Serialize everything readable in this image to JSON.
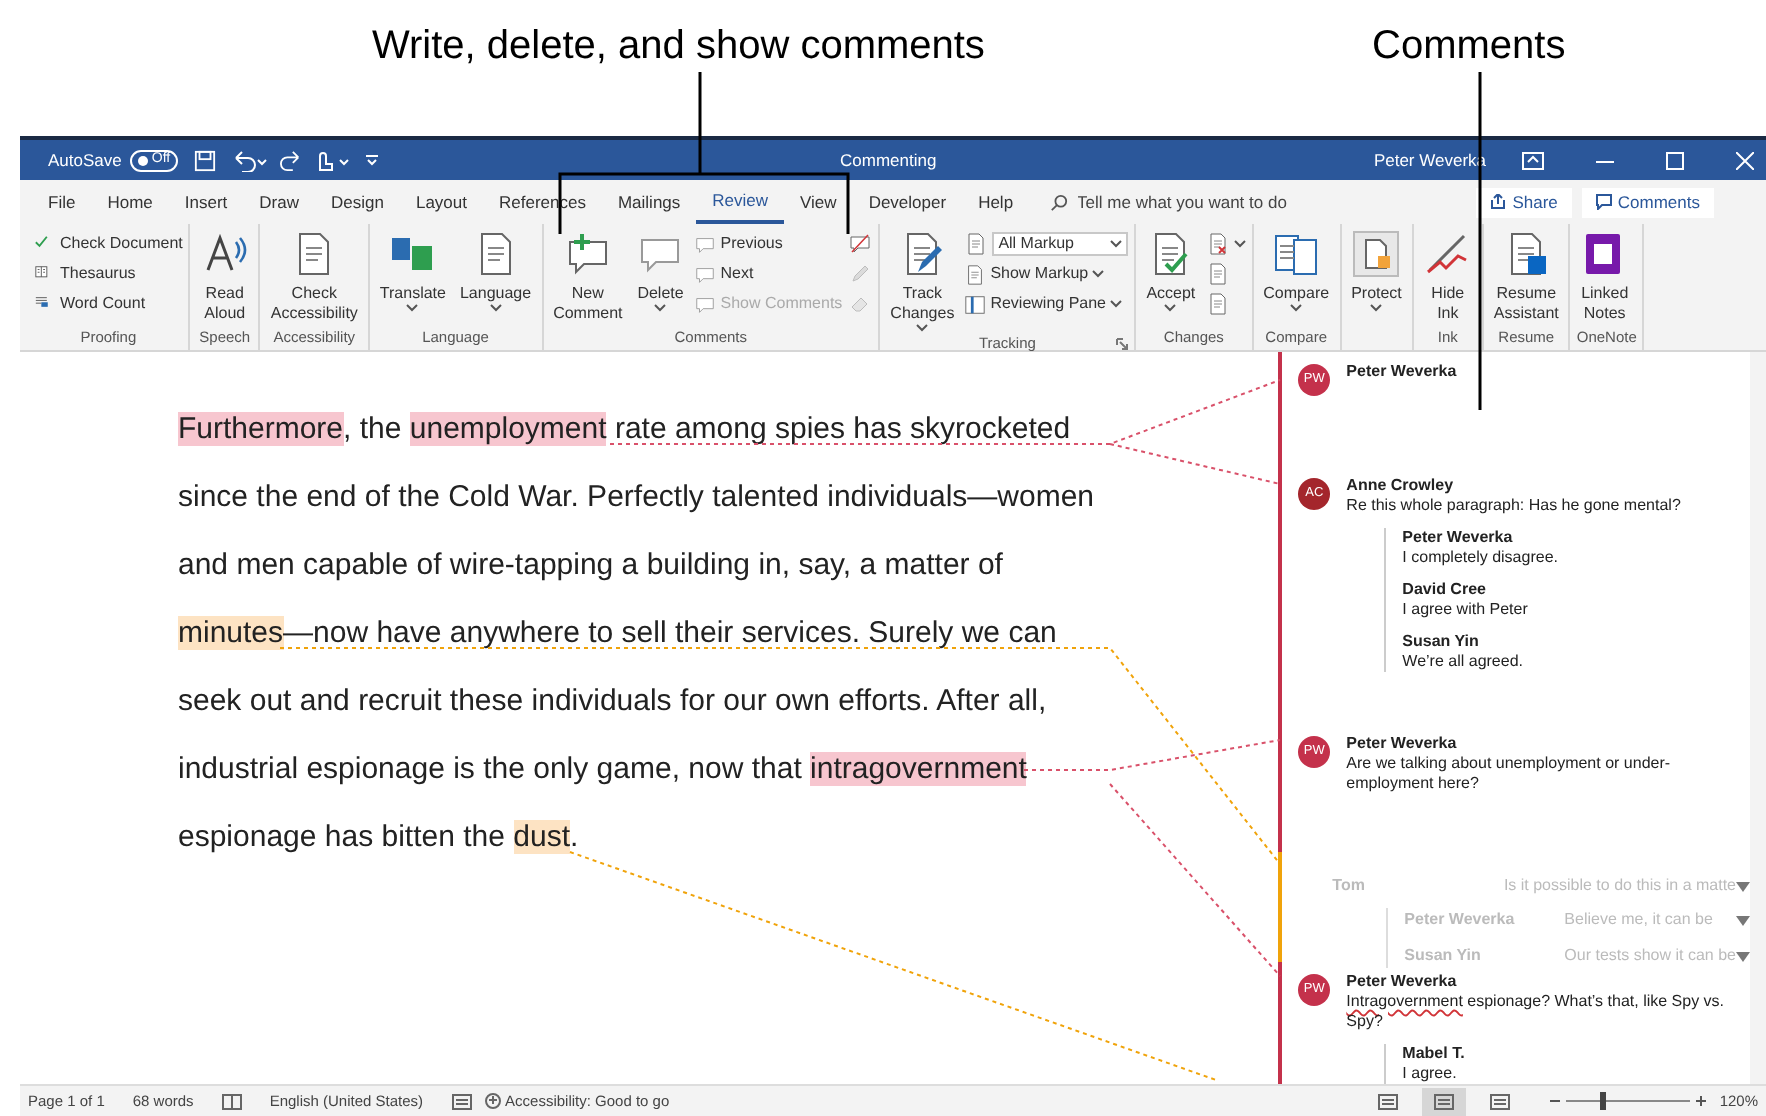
{
  "callouts": [
    {
      "text": "Write, delete, and show comments"
    },
    {
      "text": "Comments"
    }
  ],
  "title_bar": {
    "autosave": {
      "label": "AutoSave",
      "toggle": "Off",
      "on": false
    },
    "document_title": "Commenting",
    "user": "Peter Weverka"
  },
  "menu_tabs": [
    {
      "label": "File",
      "selected": false
    },
    {
      "label": "Home",
      "selected": false
    },
    {
      "label": "Insert",
      "selected": false
    },
    {
      "label": "Draw",
      "selected": false
    },
    {
      "label": "Design",
      "selected": false
    },
    {
      "label": "Layout",
      "selected": false
    },
    {
      "label": "References",
      "selected": false
    },
    {
      "label": "Mailings",
      "selected": false
    },
    {
      "label": "Review",
      "selected": true
    },
    {
      "label": "View",
      "selected": false
    },
    {
      "label": "Developer",
      "selected": false
    },
    {
      "label": "Help",
      "selected": false
    }
  ],
  "tell_me": {
    "placeholder": "Tell me what you want to do"
  },
  "share_button": "Share",
  "comments_button": "Comments",
  "ribbon_groups": [
    {
      "name": "Proofing",
      "buttons": [
        {
          "kind": "small",
          "label": "Check Document"
        },
        {
          "kind": "small",
          "label": "Thesaurus"
        },
        {
          "kind": "small",
          "label": "Word Count"
        }
      ]
    },
    {
      "name": "Speech",
      "buttons": [
        {
          "kind": "large",
          "label": "Read Aloud"
        }
      ]
    },
    {
      "name": "Accessibility",
      "buttons": [
        {
          "kind": "large",
          "label": "Check Accessibility"
        }
      ]
    },
    {
      "name": "Language",
      "buttons": [
        {
          "kind": "large",
          "label": "Translate",
          "dropdown": true
        },
        {
          "kind": "large",
          "label": "Language",
          "dropdown": true
        }
      ]
    },
    {
      "name": "Comments",
      "buttons": [
        {
          "kind": "large",
          "label": "New Comment"
        },
        {
          "kind": "large",
          "label": "Delete",
          "dropdown": true
        },
        {
          "kind": "small",
          "label": "Previous"
        },
        {
          "kind": "small",
          "label": "Next"
        },
        {
          "kind": "small",
          "label": "Show Comments",
          "disabled": true
        },
        {
          "kind": "icon"
        },
        {
          "kind": "icon",
          "disabled": true
        },
        {
          "kind": "icon",
          "disabled": true
        }
      ]
    },
    {
      "name": "Tracking",
      "launcher": true,
      "buttons": [
        {
          "kind": "large",
          "label": "Track Changes",
          "dropdown": true
        },
        {
          "kind": "select",
          "label": "All Markup"
        },
        {
          "kind": "small",
          "label": "Show Markup",
          "dropdown": true
        },
        {
          "kind": "small",
          "label": "Reviewing Pane",
          "dropdown": true
        }
      ]
    },
    {
      "name": "Changes",
      "buttons": [
        {
          "kind": "large",
          "label": "Accept",
          "dropdown": true
        },
        {
          "kind": "icon",
          "dropdown": true
        },
        {
          "kind": "icon"
        },
        {
          "kind": "icon"
        }
      ]
    },
    {
      "name": "Compare",
      "buttons": [
        {
          "kind": "large",
          "label": "Compare",
          "dropdown": true
        }
      ]
    },
    {
      "buttons": [
        {
          "kind": "large",
          "label": "Protect",
          "dropdown": true
        }
      ]
    },
    {
      "name": "Ink",
      "buttons": [
        {
          "kind": "large",
          "label": "Hide Ink"
        }
      ]
    },
    {
      "name": "Resume",
      "buttons": [
        {
          "kind": "large",
          "label": "Resume Assistant"
        }
      ]
    },
    {
      "name": "OneNote",
      "buttons": [
        {
          "kind": "large",
          "label": "Linked Notes"
        }
      ]
    }
  ],
  "document_lines": [
    [
      {
        "text": "Furthermore",
        "color": "#f7c6cf"
      },
      {
        "text": ", the "
      },
      {
        "text": "unemployment",
        "color": "#f7c6cf"
      },
      {
        "text": " rate among spies has skyrocketed"
      }
    ],
    [
      {
        "text": "since the end of the Cold War. Perfectly talented individuals—women"
      }
    ],
    [
      {
        "text": "and men capable of wire-tapping a building in, say, a matter of"
      }
    ],
    [
      {
        "text": "minutes",
        "color": "#fde3c3"
      },
      {
        "text": "—now have anywhere to sell their services. Surely we can"
      }
    ],
    [
      {
        "text": "seek out and recruit these individuals for our own efforts. After all,"
      }
    ],
    [
      {
        "text": "industrial espionage is the only game, now that "
      },
      {
        "text": "intragovernment",
        "color": "#f7c6cf"
      }
    ],
    [
      {
        "text": "espionage has bitten the "
      },
      {
        "text": "dust",
        "color": "#fde3c3"
      },
      {
        "text": "."
      }
    ]
  ],
  "comments": [
    {
      "initials": "PW",
      "author": "Peter Weverka",
      "color": "#c4314b",
      "resolved": false
    },
    {
      "initials": "AC",
      "author": "Anne Crowley",
      "color": "#a4262c",
      "resolved": false,
      "text": [
        {
          "text": "Re this whole paragraph: Has he gone mental?"
        }
      ],
      "replies": [
        {
          "author": "Peter Weverka",
          "text": "I completely disagree."
        },
        {
          "author": "David Cree",
          "text": "I agree with Peter"
        },
        {
          "author": "Susan Yin",
          "text": "We’re all agreed."
        }
      ]
    },
    {
      "initials": "PW",
      "author": "Peter Weverka",
      "color": "#c4314b",
      "resolved": false,
      "text": [
        {
          "text": "Are we talking about unemployment or under-employment here?"
        }
      ]
    },
    {
      "author": "Tom",
      "resolved": true,
      "text": [
        {
          "text": "Is it possible to do this in a matte"
        }
      ],
      "replies": [
        {
          "author": "Peter Weverka",
          "text": "Believe me, it can be"
        },
        {
          "author": "Susan Yin",
          "text": "Our tests show it can be"
        }
      ]
    },
    {
      "initials": "PW",
      "author": "Peter Weverka",
      "color": "#c4314b",
      "resolved": false,
      "text": [
        {
          "text": "Intragovernment",
          "misspelled": true
        },
        {
          "text": " espionage? What’s that, like Spy vs. Spy?"
        }
      ],
      "replies": [
        {
          "author": "Mabel T.",
          "text": "I agree."
        }
      ]
    }
  ],
  "status_bar": {
    "page": "Page 1 of 1",
    "words": "68 words",
    "language": "English (United States)",
    "accessibility": "Accessibility: Good to go",
    "views": [
      {
        "selected": false
      },
      {
        "selected": true
      },
      {
        "selected": false
      }
    ],
    "zoom_slider": {
      "level": 0.3
    },
    "zoom": "120%"
  }
}
